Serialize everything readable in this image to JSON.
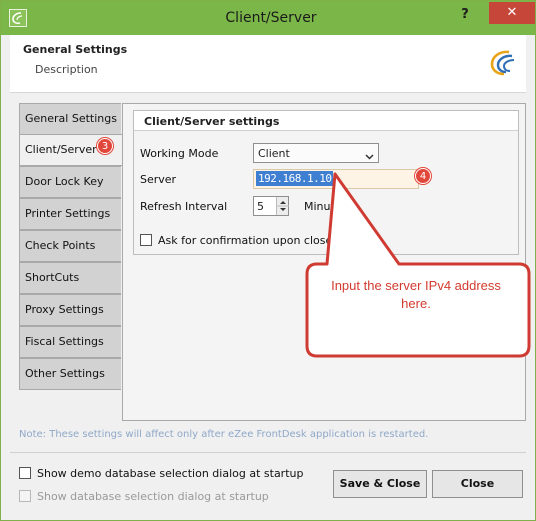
{
  "window": {
    "title": "Client/Server",
    "help_label": "?",
    "close_label": "✕"
  },
  "header": {
    "title": "General Settings",
    "description": "Description",
    "logo_icon": "ezee-swirl-logo"
  },
  "nav": {
    "items": [
      {
        "label": "General Settings"
      },
      {
        "label": "Client/Server"
      },
      {
        "label": "Door Lock Key"
      },
      {
        "label": "Printer Settings"
      },
      {
        "label": "Check Points"
      },
      {
        "label": "ShortCuts"
      },
      {
        "label": "Proxy Settings"
      },
      {
        "label": "Fiscal Settings"
      },
      {
        "label": "Other Settings"
      }
    ],
    "active_index": 1
  },
  "panel": {
    "title": "Client/Server settings",
    "working_mode_label": "Working Mode",
    "working_mode_value": "Client",
    "server_label": "Server",
    "server_value": "192.168.1.10",
    "refresh_label": "Refresh Interval",
    "refresh_value": "5",
    "refresh_unit": "Minutes",
    "confirm_close_label": "Ask for confirmation upon close shift"
  },
  "annotations": {
    "badge_nav": "3",
    "badge_server": "4",
    "callout_text": "Input the server IPv4 address here.",
    "accent_color": "#e2473b"
  },
  "note": "Note: These settings will affect only after eZee FrontDesk application is restarted.",
  "footer": {
    "show_demo_db_label": "Show demo database selection dialog at startup",
    "show_db_label": "Show database selection dialog at startup",
    "save_close_label": "Save & Close",
    "close_label": "Close"
  },
  "colors": {
    "titlebar": "#7ab648",
    "close_button": "#c7463a",
    "server_highlight": "#3e7fd2"
  }
}
